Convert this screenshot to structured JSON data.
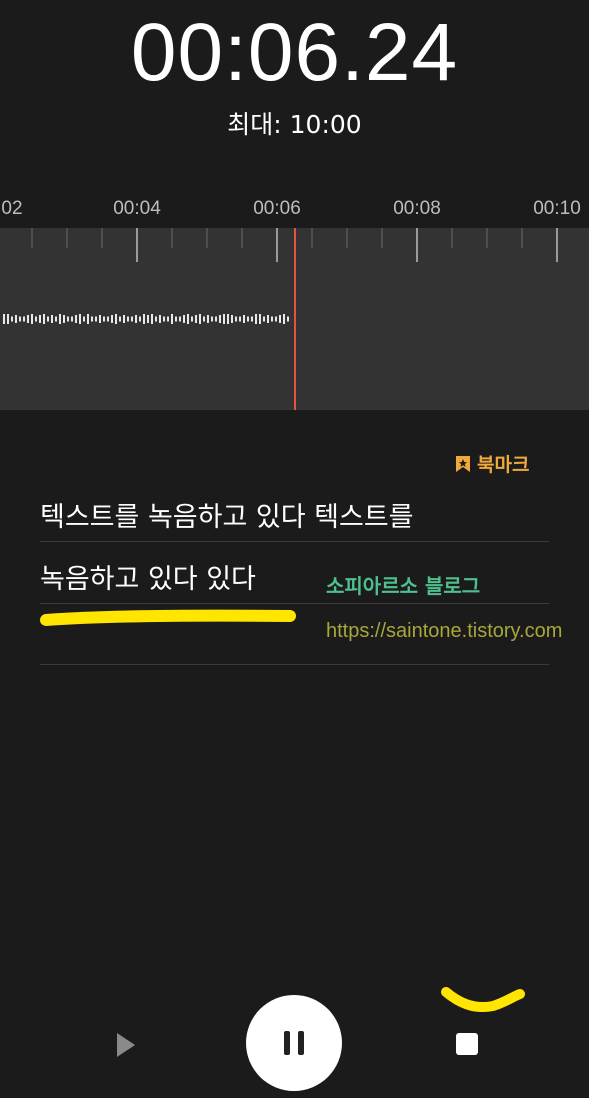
{
  "recorder": {
    "timer": "00:06.24",
    "max_label": "최대: 10:00",
    "ruler_labels": [
      "02",
      "00:04",
      "00:06",
      "00:08",
      "00:10"
    ]
  },
  "bookmark": {
    "label": "북마크",
    "icon": "bookmark-star-icon",
    "color": "#f0a93b"
  },
  "transcript": {
    "line1": "텍스트를 녹음하고 있다 텍스트를",
    "line2": "녹음하고 있다 있다"
  },
  "watermark": {
    "title": "소피아르소 블로그",
    "url": "https://saintone.tistory.com"
  },
  "controls": {
    "play_icon": "play-icon",
    "pause_icon": "pause-icon",
    "stop_icon": "stop-icon"
  },
  "colors": {
    "background": "#1b1b1b",
    "waveform_bg": "#333333",
    "playhead": "#e0553c",
    "highlight": "#ffe500"
  }
}
